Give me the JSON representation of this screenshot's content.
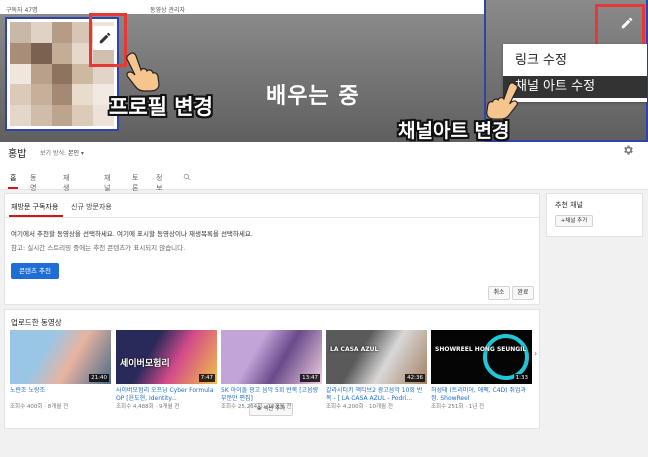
{
  "topbar": {
    "subscribers": "구독자 47명",
    "video_manager": "동영상 관리자"
  },
  "banner": {
    "title": "배우는 중"
  },
  "annotations": {
    "profile_change": "프로필 변경",
    "art_change": "채널아트 변경"
  },
  "art_menu": {
    "items": [
      "링크 수정",
      "채널 아트 수정"
    ],
    "selected": 1
  },
  "channel": {
    "name": "홍밥",
    "view_mode_label": "보기 방식:",
    "view_mode_value": "본인"
  },
  "tabs": [
    "홈",
    "동영상",
    "재생목록",
    "채널",
    "토론",
    "정보"
  ],
  "featured": {
    "tabs": [
      "재방문 구독자용",
      "신규 방문자용"
    ],
    "description": "여기에서 추천할 동영상을 선택하세요. 여기에 표시할 동영상이나 재생목록을 선택하세요.",
    "note": "참고: 실시간 스트리밍 중에는 추천 콘텐츠가 표시되지 않습니다.",
    "recommend_button": "콘텐츠 추천",
    "cancel_button": "취소",
    "done_button": "완료"
  },
  "sidebar": {
    "title": "추천 채널",
    "add_button": "+채널 추가"
  },
  "uploads": {
    "title": "업로드한 동영상",
    "add_section": "섹션 추가",
    "videos": [
      {
        "title": "노란조 노랑조",
        "meta": "조회수 400회 · 8개월 전",
        "duration": "21:40",
        "colors": [
          "#9ac6e6",
          "#e8b4a0",
          "#4a6a8a"
        ]
      },
      {
        "title": "사이버모험리 오프닝 Cyber Formula OP [윤도현, Identity...",
        "meta": "조회수 4,488회 · 9개월 전",
        "duration": "7:47",
        "colors": [
          "#2a2a5a",
          "#d24a8a",
          "#f2c24a"
        ]
      },
      {
        "title": "5K 아이돌 광고 음악 5회 반복 [고음량 부분만 편집]",
        "meta": "조회수 25,264회 · 10개월 전",
        "duration": "13:47",
        "colors": [
          "#c2a4d8",
          "#6a4a8a",
          "#f0d0e0"
        ]
      },
      {
        "title": "갈라시티키 액티브2 광고음악 10회 반복 - [ LA CASA AZUL - Podri...",
        "meta": "조회수 4,200회 · 10개월 전",
        "duration": "42:36",
        "colors": [
          "#5a5a5a",
          "#d8d8d8",
          "#a48060"
        ]
      },
      {
        "title": "허성태 (트리미어, 애펙, C4D) 취업과정. ShowReel",
        "meta": "조회수 251회 · 1년 전",
        "duration": "1:33",
        "colors": [
          "#0a0a0a",
          "#1ec8d8",
          "#ffffff"
        ]
      }
    ],
    "thumb_texts": [
      "",
      "세이버모험리",
      "",
      "LA CASA AZUL",
      "SHOWREEL HONG SEUNGIL"
    ]
  }
}
